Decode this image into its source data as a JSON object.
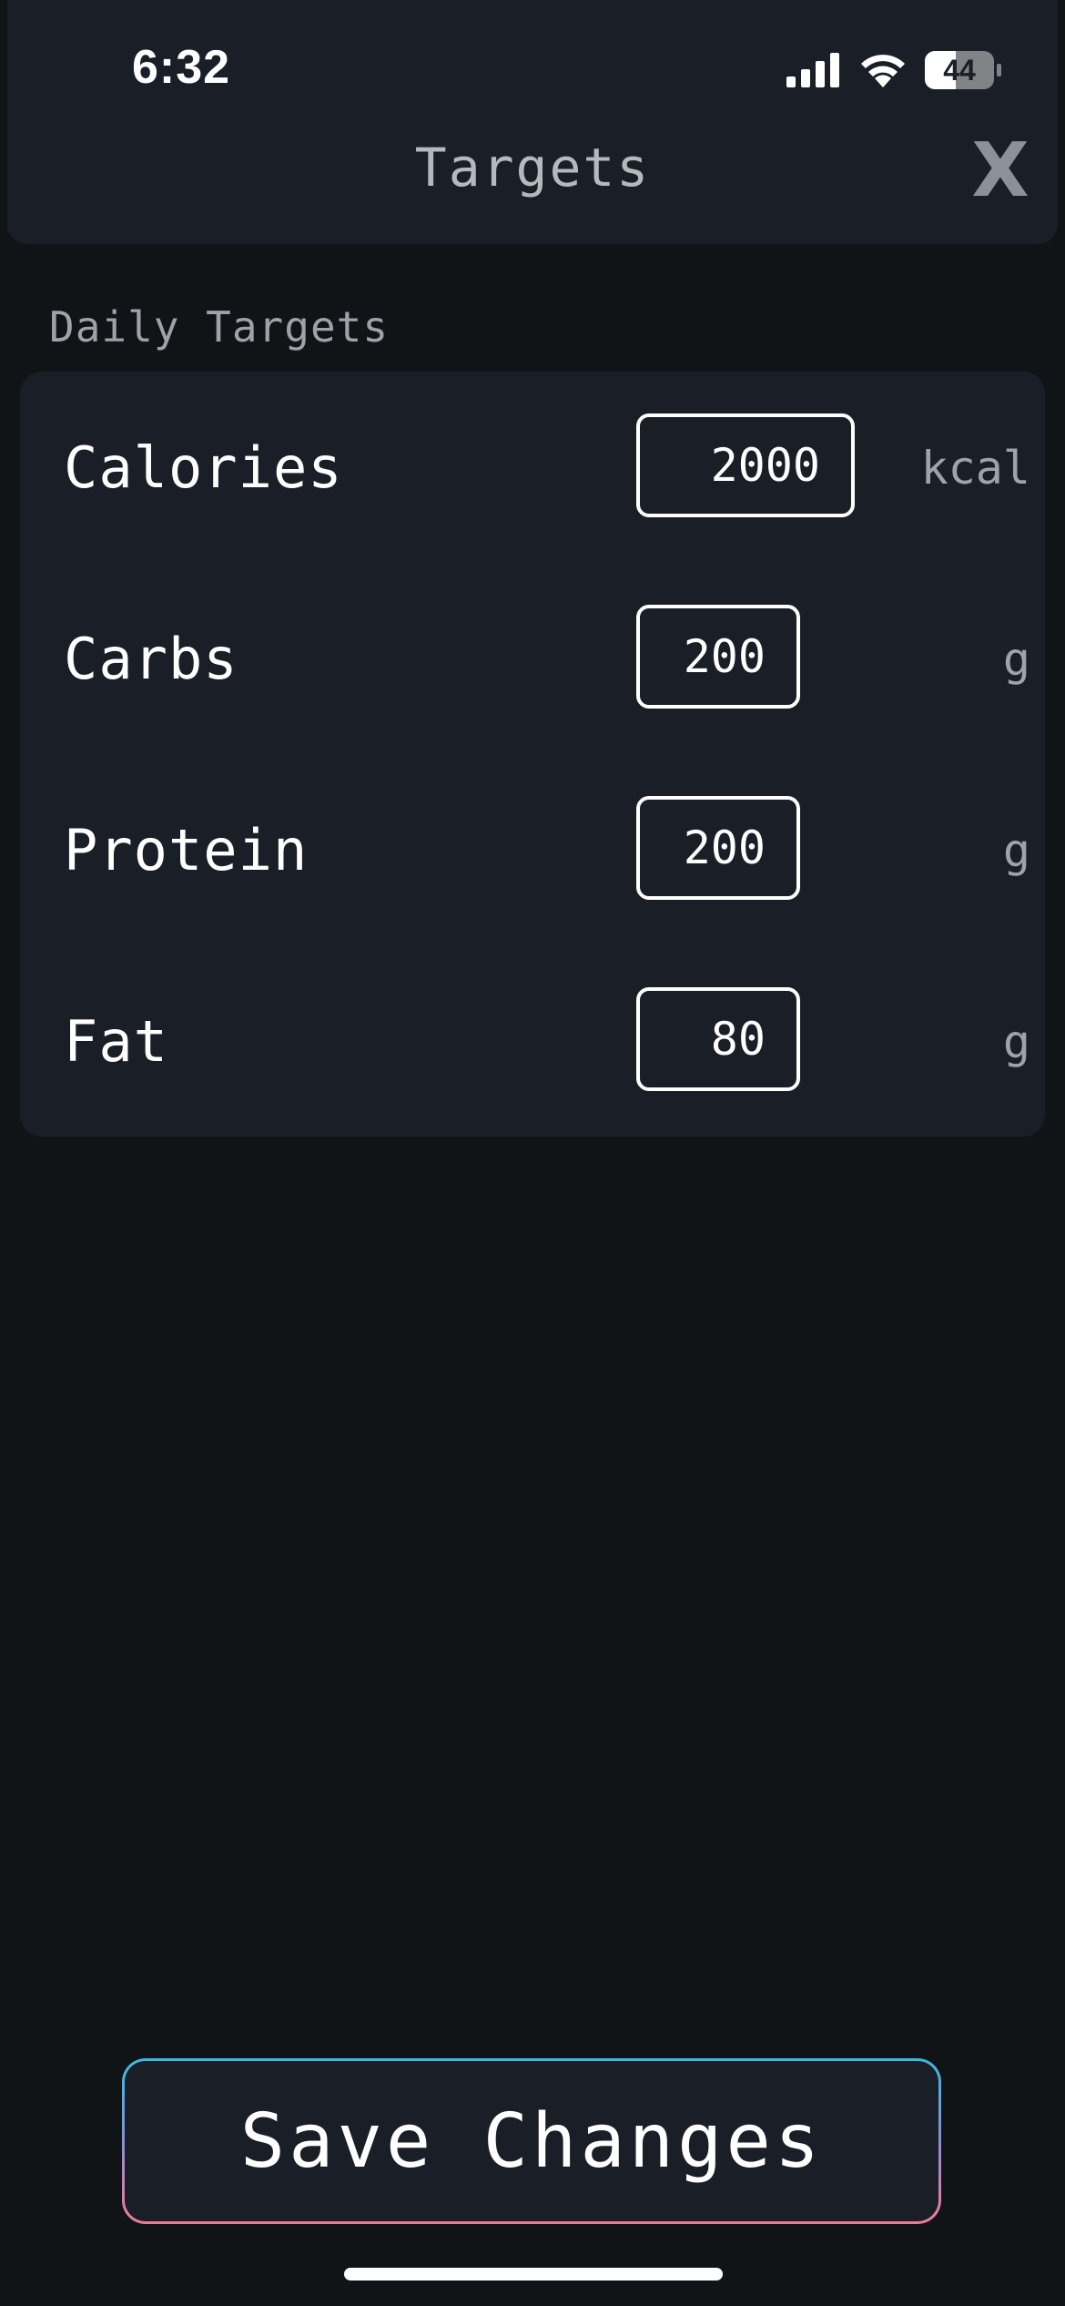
{
  "status_bar": {
    "time": "6:32",
    "battery": "44",
    "icons": [
      "signal-icon",
      "wifi-icon",
      "battery-icon"
    ]
  },
  "header": {
    "title": "Targets",
    "close_label": "X"
  },
  "section": {
    "label": "Daily Targets"
  },
  "targets": [
    {
      "label": "Calories",
      "value": "2000",
      "unit": "kcal"
    },
    {
      "label": "Carbs",
      "value": "200",
      "unit": "g"
    },
    {
      "label": "Protein",
      "value": "200",
      "unit": "g"
    },
    {
      "label": "Fat",
      "value": "80",
      "unit": "g"
    }
  ],
  "actions": {
    "save_label": "Save Changes"
  },
  "colors": {
    "background": "#111416",
    "card": "#1a1e26",
    "muted_text": "#9ea2aa",
    "button_gradient_top": "#3bb9e0",
    "button_gradient_bottom": "#f07b95"
  }
}
